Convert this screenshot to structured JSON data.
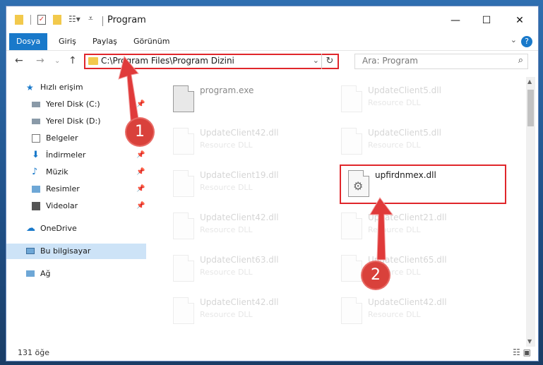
{
  "window": {
    "title": "Program"
  },
  "ribbon": {
    "tabs": [
      {
        "label": "Dosya"
      },
      {
        "label": "Giriş"
      },
      {
        "label": "Paylaş"
      },
      {
        "label": "Görünüm"
      }
    ]
  },
  "address": {
    "path": "C:\\Program Files\\Program Dizini"
  },
  "search": {
    "placeholder": "Ara: Program"
  },
  "sidebar": {
    "items": [
      {
        "label": "Hızlı erişim"
      },
      {
        "label": "Yerel Disk (C:)"
      },
      {
        "label": "Yerel Disk (D:)"
      },
      {
        "label": "Belgeler"
      },
      {
        "label": "İndirmeler"
      },
      {
        "label": "Müzik"
      },
      {
        "label": "Resimler"
      },
      {
        "label": "Videolar"
      },
      {
        "label": "OneDrive"
      },
      {
        "label": "Bu bilgisayar"
      },
      {
        "label": "Ağ"
      }
    ]
  },
  "files": [
    {
      "name": "program.exe",
      "type": ""
    },
    {
      "name": "UpdateClient5.dll",
      "type": "Resource DLL"
    },
    {
      "name": "UpdateClient42.dll",
      "type": "Resource DLL"
    },
    {
      "name": "UpdateClient5.dll",
      "type": "Resource DLL"
    },
    {
      "name": "UpdateClient19.dll",
      "type": "Resource DLL"
    },
    {
      "name": "upfirdnmex.dll",
      "type": ""
    },
    {
      "name": "UpdateClient42.dll",
      "type": "Resource DLL"
    },
    {
      "name": "UpdateClient21.dll",
      "type": "Resource DLL"
    },
    {
      "name": "UpdateClient63.dll",
      "type": "Resource DLL"
    },
    {
      "name": "UpdateClient65.dll",
      "type": "Resource DLL"
    },
    {
      "name": "UpdateClient42.dll",
      "type": "Resource DLL"
    },
    {
      "name": "UpdateClient42.dll",
      "type": "Resource DLL"
    }
  ],
  "annotations": {
    "step1": "1",
    "step2": "2"
  },
  "status": {
    "count": "131 öğe"
  },
  "colors": {
    "accent": "#1979ca",
    "highlight": "#e0262b",
    "selected": "#cde3f7"
  }
}
